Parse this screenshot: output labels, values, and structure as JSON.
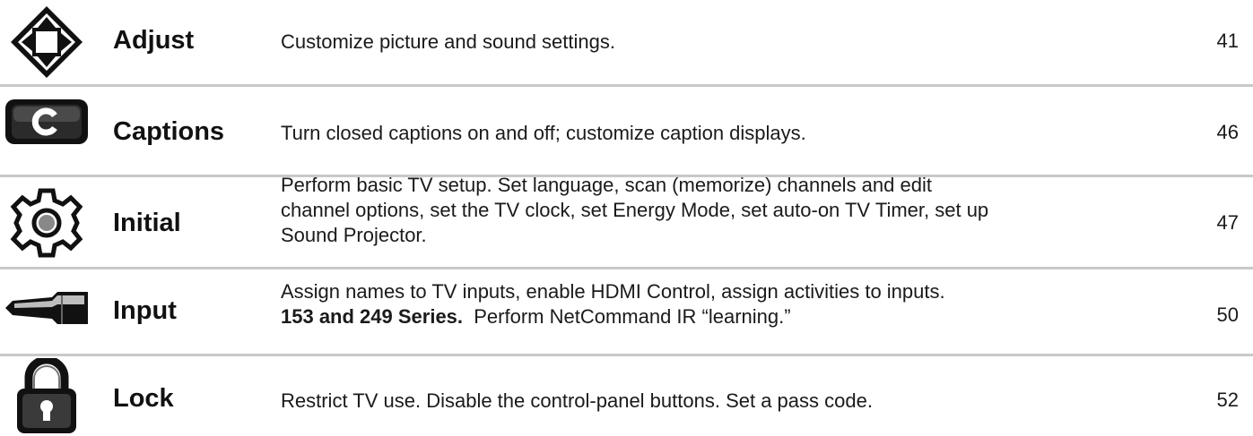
{
  "rows": [
    {
      "icon": "arrow-cross-icon",
      "title": "Adjust",
      "desc": "Customize picture and sound settings.",
      "page": "41"
    },
    {
      "icon": "captions-c-icon",
      "title": "Captions",
      "desc": "Turn closed captions on and off; customize caption displays.",
      "page": "46"
    },
    {
      "icon": "gear-icon",
      "title": "Initial",
      "desc_lines": [
        "Perform basic TV setup.  Set language, scan (memorize) channels and edit",
        "channel options, set the TV clock, set Energy Mode, set auto-on TV Timer, set up",
        "Sound Projector."
      ],
      "page": "47"
    },
    {
      "icon": "input-cable-icon",
      "title": "Input",
      "desc_line1": "Assign names to TV inputs, enable HDMI Control, assign activities to inputs.",
      "desc_bold": "153 and 249 Series.",
      "desc_rest": "  Perform NetCommand IR “learning.”",
      "page": "50"
    },
    {
      "icon": "padlock-icon",
      "title": "Lock",
      "desc": "Restrict TV use.  Disable the control-panel buttons.  Set a pass code.",
      "page": "52"
    }
  ]
}
